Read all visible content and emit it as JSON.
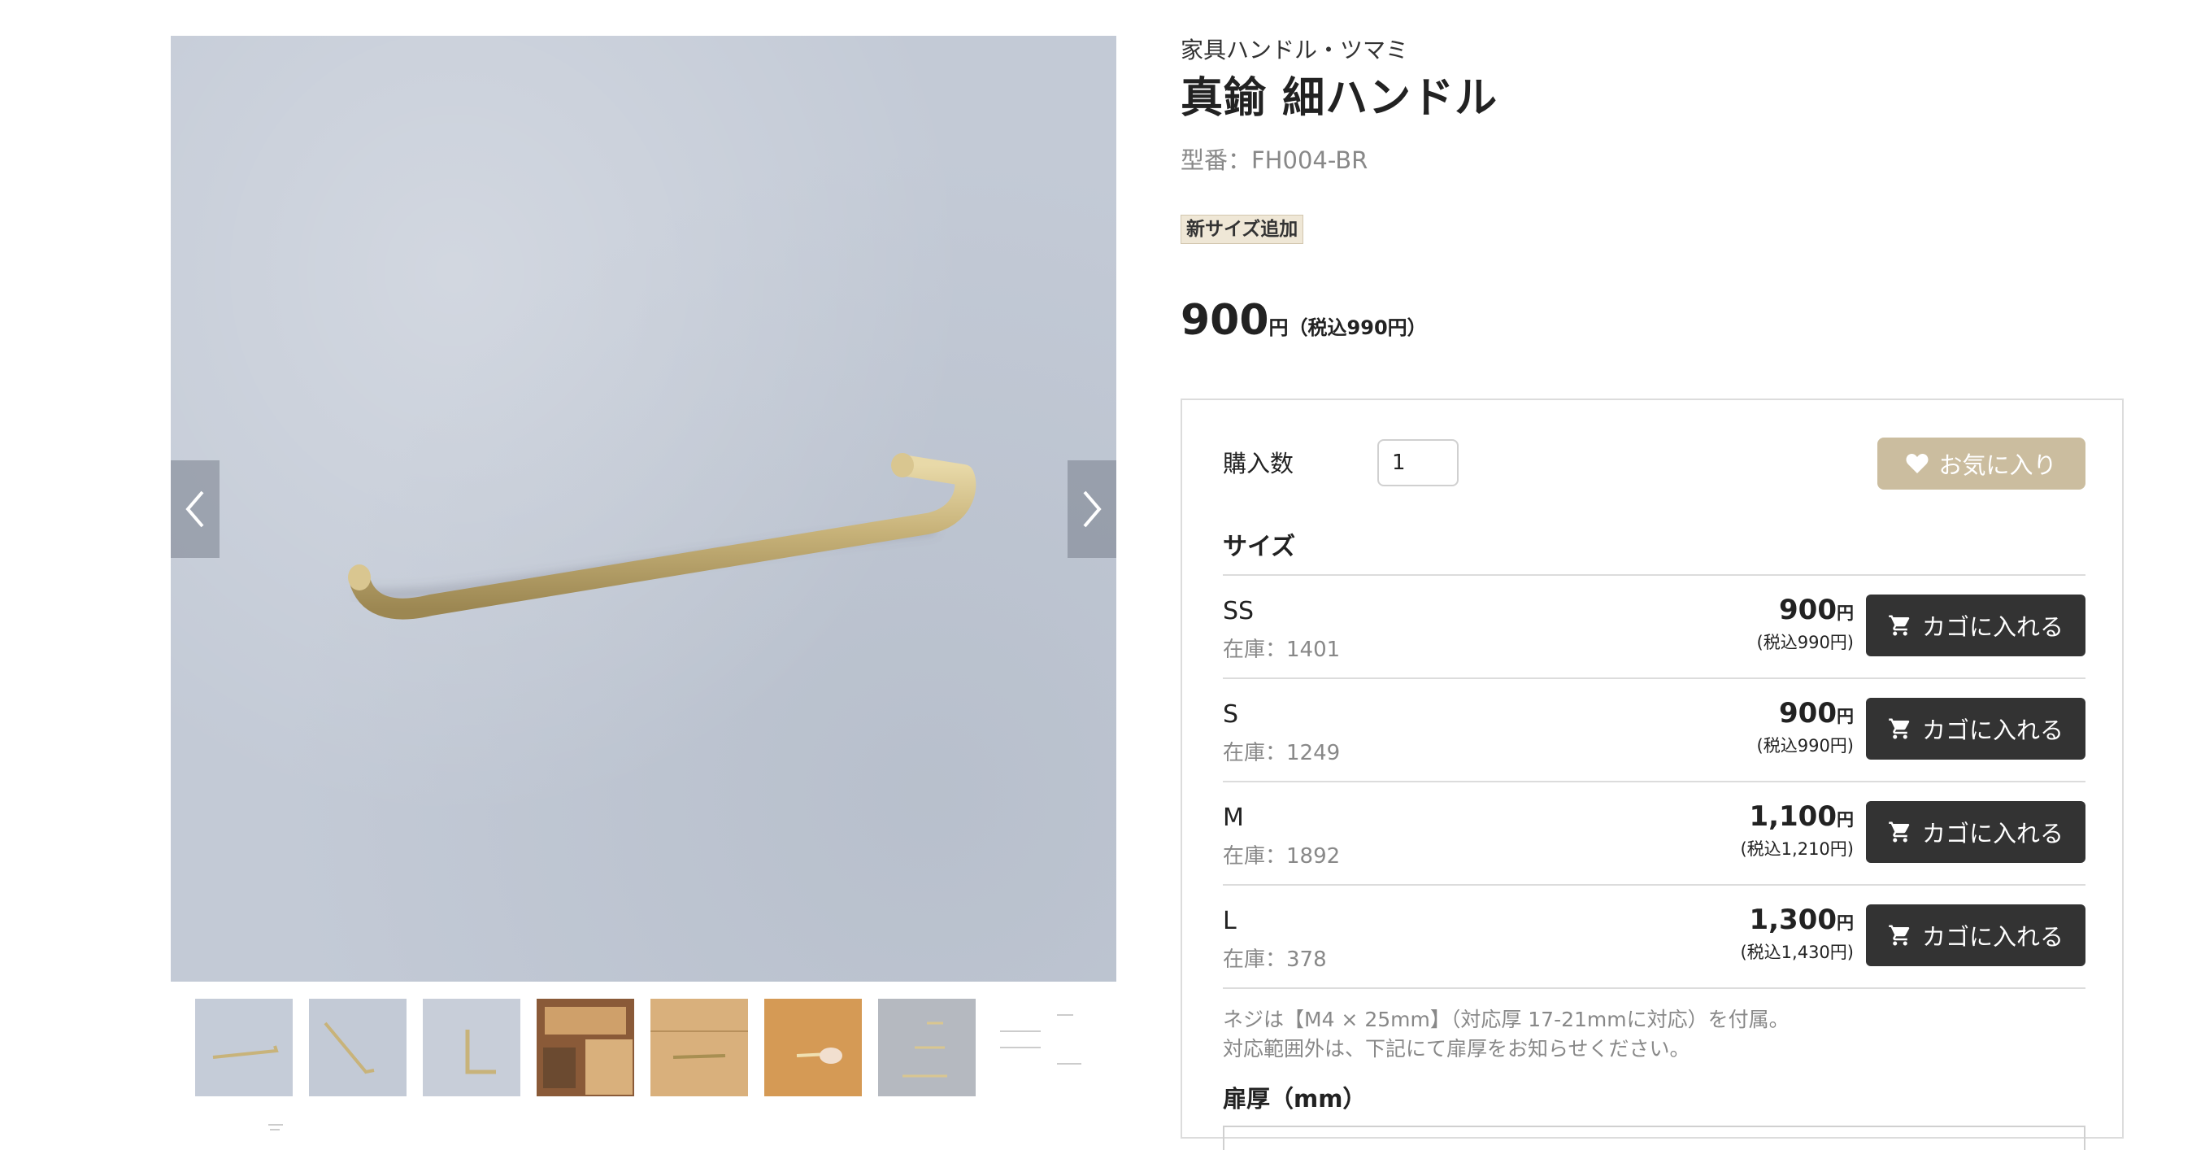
{
  "product": {
    "category": "家具ハンドル・ツマミ",
    "title": "真鍮 細ハンドル",
    "model": "型番：FH004-BR",
    "badge": "新サイズ追加",
    "price": {
      "value": "900",
      "unit": "円",
      "tax_included": "（税込990円）"
    }
  },
  "gallery": {
    "prev_icon": "chevron-left-icon",
    "next_icon": "chevron-right-icon",
    "thumbnail_count": 9
  },
  "purchase": {
    "qty_label": "購入数",
    "qty_value": "1",
    "favorite_label": "お気に入り",
    "favorite_icon": "heart-icon",
    "size_heading": "サイズ",
    "cart_icon": "cart-icon",
    "sizes": [
      {
        "name": "SS",
        "stock": "在庫：1401",
        "price": "900",
        "unit": "円",
        "tax": "(税込990円)",
        "cart_label": "カゴに入れる"
      },
      {
        "name": "S",
        "stock": "在庫：1249",
        "price": "900",
        "unit": "円",
        "tax": "(税込990円)",
        "cart_label": "カゴに入れる"
      },
      {
        "name": "M",
        "stock": "在庫：1892",
        "price": "1,100",
        "unit": "円",
        "tax": "(税込1,210円)",
        "cart_label": "カゴに入れる"
      },
      {
        "name": "L",
        "stock": "在庫：378",
        "price": "1,300",
        "unit": "円",
        "tax": "(税込1,430円)",
        "cart_label": "カゴに入れる"
      }
    ],
    "note_line1": "ネジは【M4 × 25mm】（対応厚 17-21mmに対応）を付属。",
    "note_line2": "対応範囲外は、下記にて扉厚をお知らせください。",
    "thickness_label": "扉厚（mm）"
  },
  "colors": {
    "dark_button": "#333333",
    "favorite_button": "#cbbd9f",
    "badge_bg": "#efe7d6",
    "muted_text": "#888888"
  }
}
